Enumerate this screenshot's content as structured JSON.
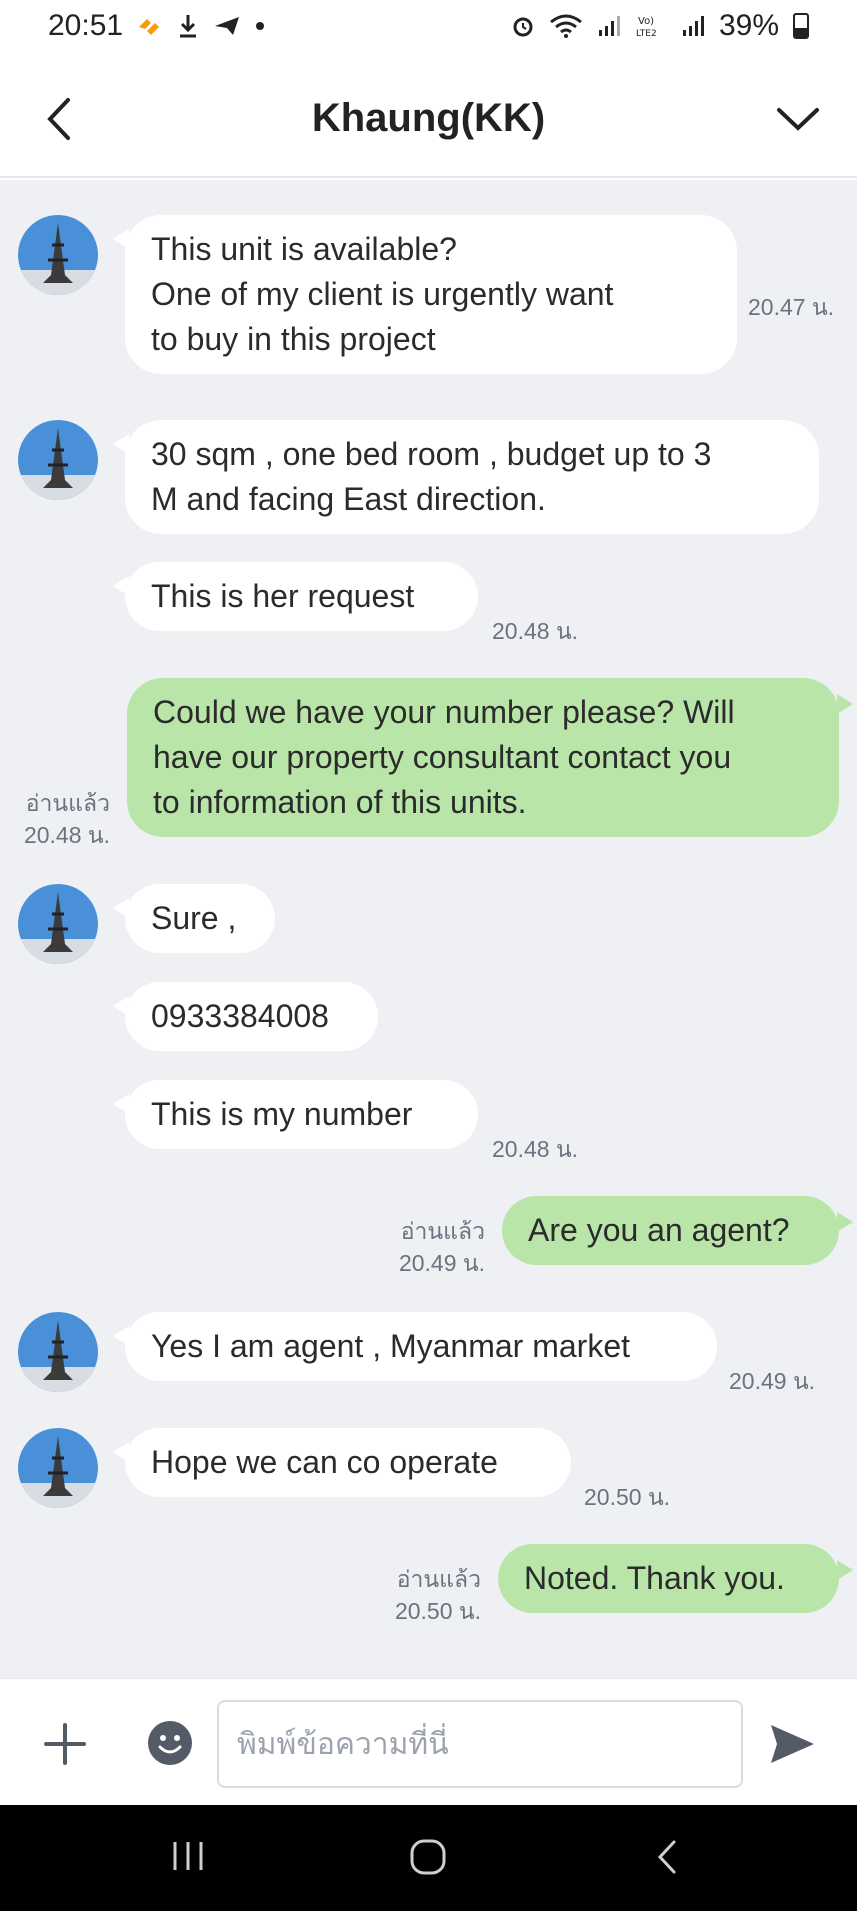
{
  "status_bar": {
    "time": "20:51",
    "battery": "39%",
    "battery_level": 0.39,
    "icons": [
      "app-notification-icon",
      "download-icon",
      "send-icon",
      "dot-icon",
      "alarm-icon",
      "wifi-icon",
      "signal-icon",
      "volte-icon",
      "signal-icon",
      "battery-icon"
    ]
  },
  "header": {
    "title": "Khaung(KK)",
    "back_icon": "chevron-left-icon",
    "menu_icon": "chevron-down-icon"
  },
  "chat": {
    "messages": [
      {
        "dir": "in",
        "lines": [
          "This unit is available?",
          "One of my client is urgently want",
          "to buy in this project"
        ],
        "time": "20.47 น."
      },
      {
        "dir": "in",
        "lines": [
          "30 sqm , one bed room , budget up to 3",
          "M and facing East direction."
        ],
        "time": ""
      },
      {
        "dir": "in",
        "lines": [
          "This is her request"
        ],
        "time": "20.48 น."
      },
      {
        "dir": "out",
        "lines": [
          "Could we have your number please? Will",
          "have our property consultant contact you",
          "to information of this units."
        ],
        "read": "อ่านแล้ว",
        "time": "20.48 น."
      },
      {
        "dir": "in",
        "lines": [
          "Sure ,"
        ],
        "time": ""
      },
      {
        "dir": "in",
        "lines": [
          "0933384008"
        ],
        "time": ""
      },
      {
        "dir": "in",
        "lines": [
          "This is my number"
        ],
        "time": "20.48 น."
      },
      {
        "dir": "out",
        "lines": [
          "Are you an agent?"
        ],
        "read": "อ่านแล้ว",
        "time": "20.49 น."
      },
      {
        "dir": "in",
        "lines": [
          "Yes I am agent , Myanmar market"
        ],
        "time": "20.49 น."
      },
      {
        "dir": "in",
        "lines": [
          "Hope we can co operate"
        ],
        "time": "20.50 น."
      },
      {
        "dir": "out",
        "lines": [
          "Noted. Thank you."
        ],
        "read": "อ่านแล้ว",
        "time": "20.50 น."
      }
    ]
  },
  "input_bar": {
    "placeholder": "พิมพ์ข้อความที่นี่",
    "value": "",
    "icons": [
      "plus-icon",
      "emoji-icon",
      "send-icon"
    ]
  },
  "nav_bar": {
    "icons": [
      "recent-apps-icon",
      "home-icon",
      "back-icon"
    ]
  },
  "colors": {
    "chat_background": "#eef0f3",
    "incoming_bubble": "#ffffff",
    "outgoing_bubble": "#b9e6a8",
    "timestamp": "#6b7280"
  }
}
